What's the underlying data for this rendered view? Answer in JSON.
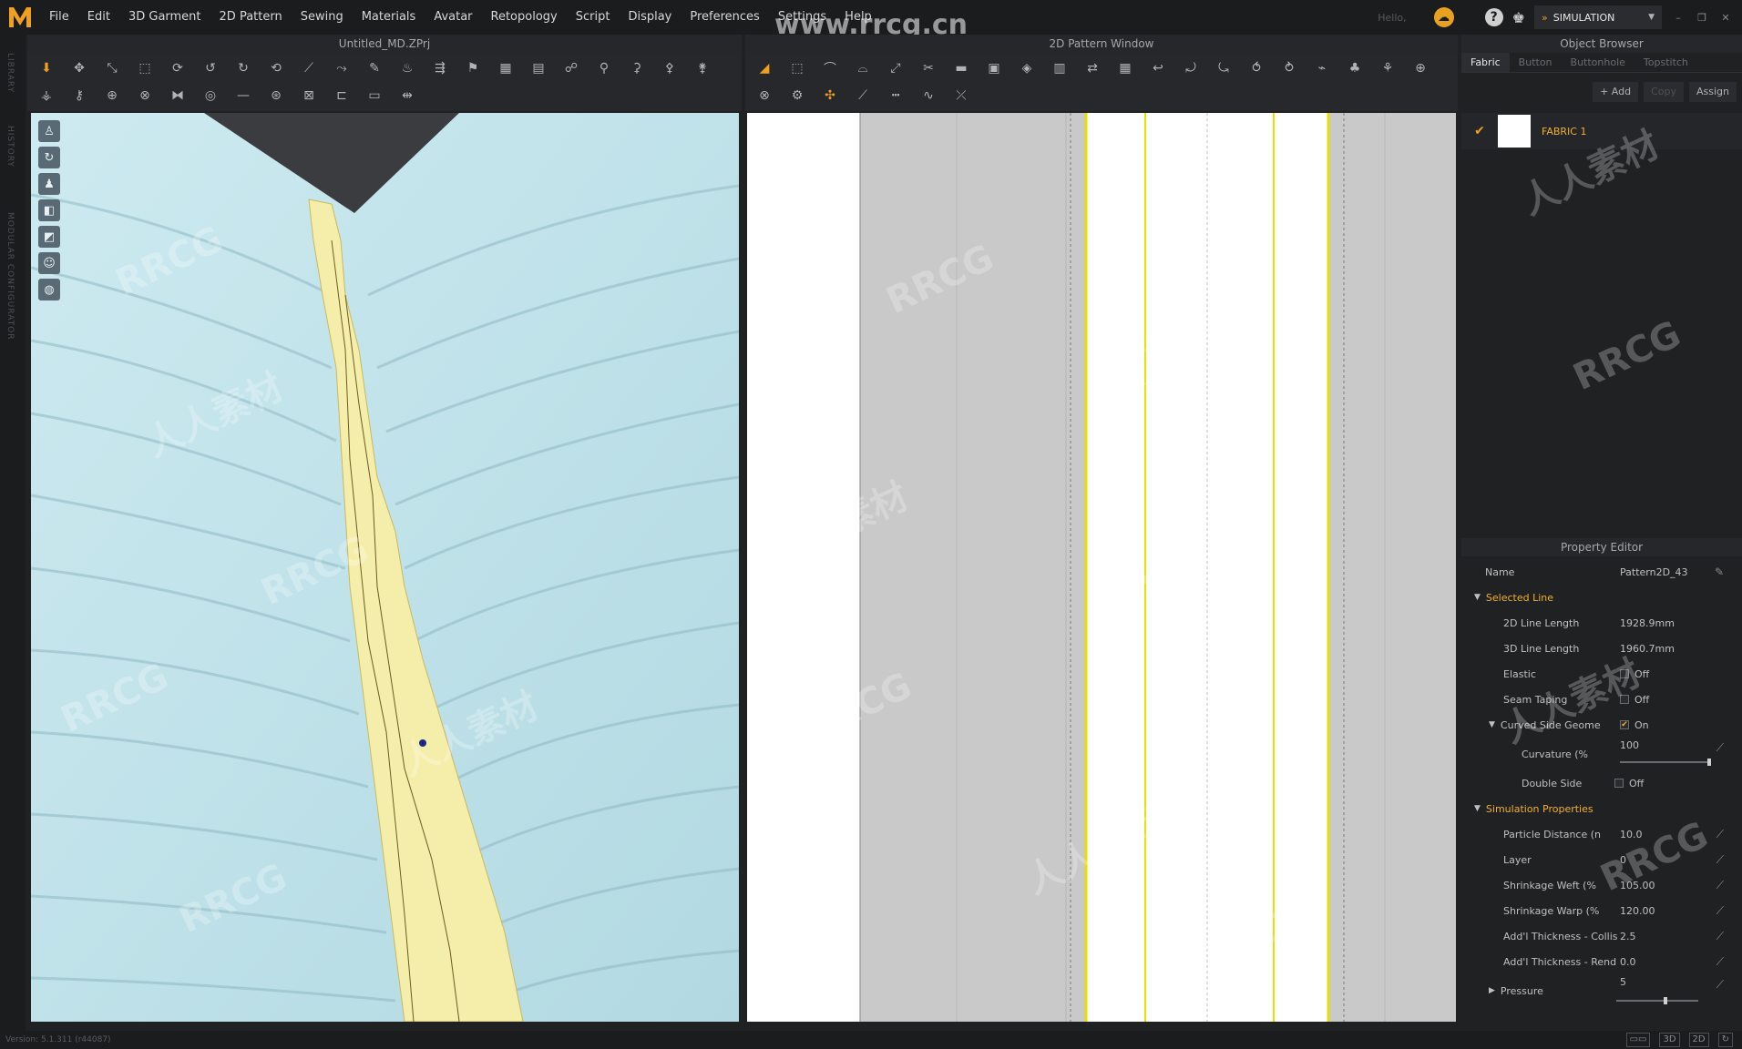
{
  "app": {
    "logo": "M",
    "document_title": "Untitled_MD.ZPrj"
  },
  "menu": [
    "File",
    "Edit",
    "3D Garment",
    "2D Pattern",
    "Sewing",
    "Materials",
    "Avatar",
    "Retopology",
    "Script",
    "Display",
    "Preferences",
    "Settings",
    "Help"
  ],
  "topbar": {
    "hello": "Hello,",
    "mode": "SIMULATION",
    "watermark": "www.rrcg.cn"
  },
  "left_strip": [
    "LIBRARY",
    "HISTORY",
    "MODULAR CONFIGURATOR"
  ],
  "panels": {
    "window_2d_title": "2D Pattern Window"
  },
  "watermarks": [
    "RRCG",
    "人人素材"
  ],
  "object_browser": {
    "title": "Object Browser",
    "tabs": [
      "Fabric",
      "Button",
      "Buttonhole",
      "Topstitch"
    ],
    "actions": {
      "add": "+ Add",
      "copy": "Copy",
      "assign": "Assign"
    },
    "fabric_name": "FABRIC 1"
  },
  "property_editor": {
    "title": "Property Editor",
    "name_label": "Name",
    "name_value": "Pattern2D_43",
    "selected_line": {
      "header": "Selected Line",
      "line_2d_label": "2D Line Length",
      "line_2d_value": "1928.9mm",
      "line_3d_label": "3D Line Length",
      "line_3d_value": "1960.7mm",
      "elastic_label": "Elastic",
      "elastic_value": "Off",
      "seam_taping_label": "Seam Taping",
      "seam_taping_value": "Off",
      "curved_label": "Curved Side Geome",
      "curved_value": "On",
      "curvature_label": "Curvature (%",
      "curvature_value": "100",
      "double_side_label": "Double Side",
      "double_side_value": "Off"
    },
    "simulation": {
      "header": "Simulation Properties",
      "particle_label": "Particle Distance (n",
      "particle_value": "10.0",
      "layer_label": "Layer",
      "layer_value": "0",
      "weft_label": "Shrinkage Weft (%",
      "weft_value": "105.00",
      "warp_label": "Shrinkage Warp (%",
      "warp_value": "120.00",
      "collision_label": "Add'l Thickness - Collisi",
      "collision_value": "2.5",
      "render_label": "Add'l Thickness - Rend",
      "render_value": "0.0",
      "pressure_label": "Pressure",
      "pressure_value": "5"
    }
  },
  "status": {
    "version": "Version: 5.1.311 (r44087)",
    "view_buttons": [
      "3D",
      "2D"
    ]
  },
  "colors": {
    "accent": "#f0b030",
    "fabric_blue": "#bfe3ea",
    "trim_yellow": "#f5eeab",
    "pattern_line": "#e6e000"
  }
}
